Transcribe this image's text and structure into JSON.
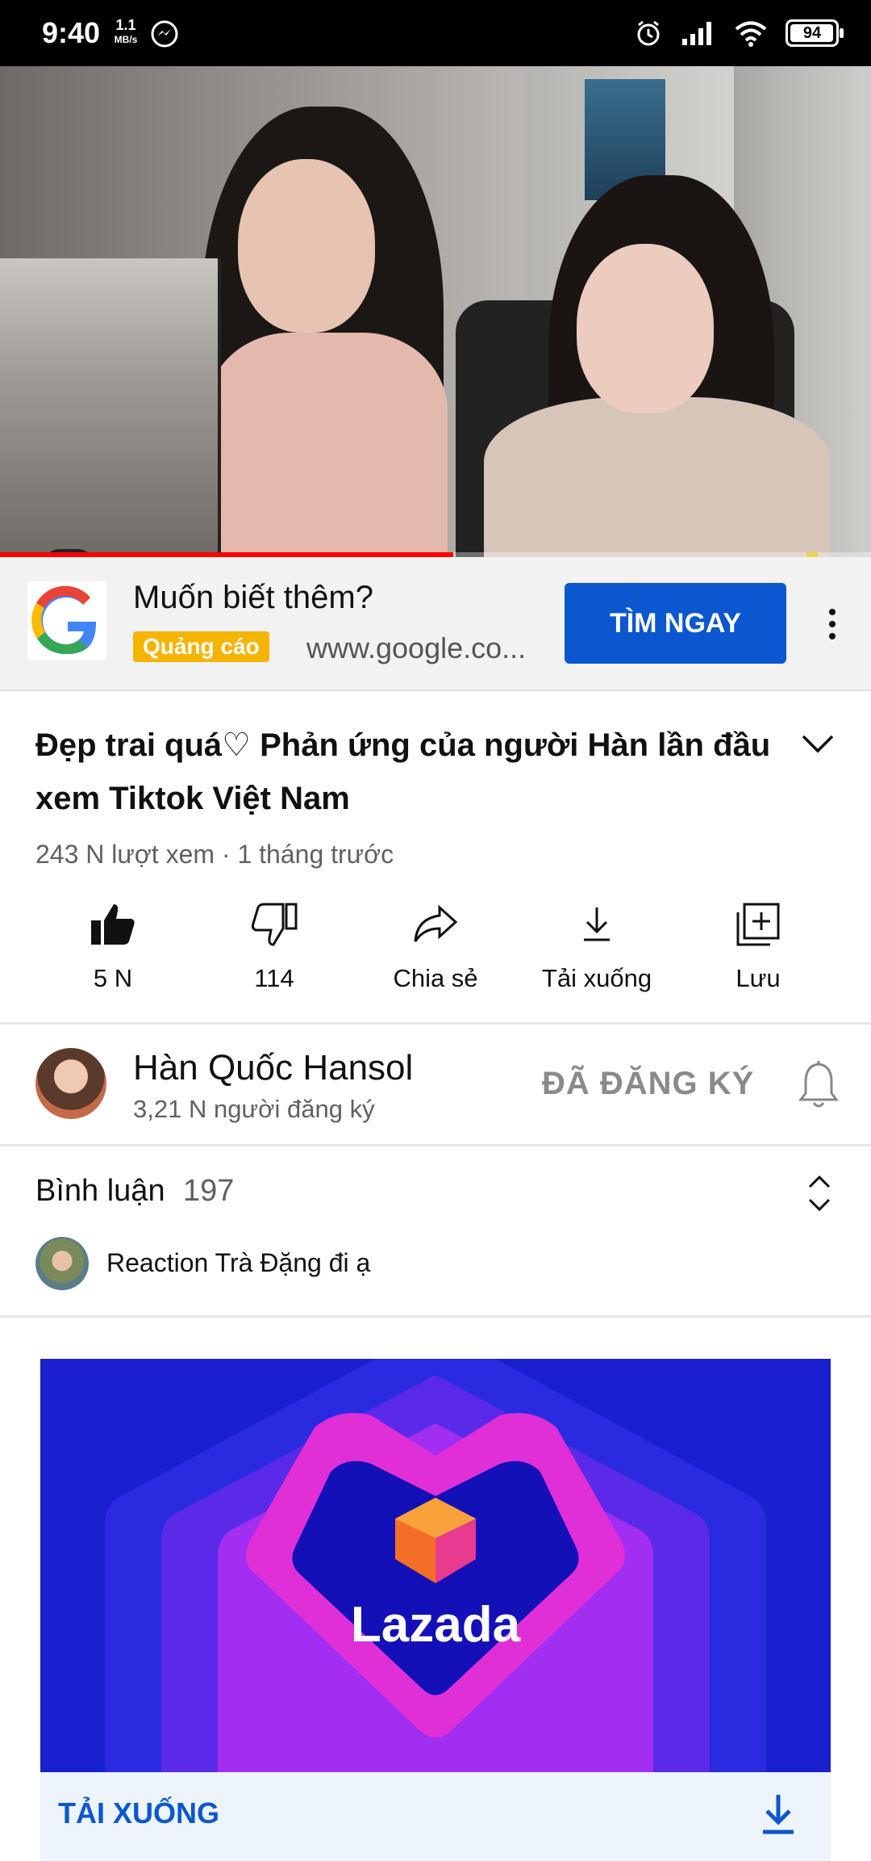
{
  "status_bar": {
    "time": "9:40",
    "speed_value": "1.1",
    "speed_unit": "MB/s",
    "battery": "94"
  },
  "player": {
    "progress_fraction": 0.52,
    "accent_color": "#ff0000"
  },
  "ad_banner": {
    "title": "Muốn biết thêm?",
    "badge": "Quảng cáo",
    "url": "www.google.co...",
    "cta": "TÌM NGAY"
  },
  "video": {
    "title": "Đẹp trai quá♡ Phản ứng của người Hàn lần đầu xem Tiktok Việt Nam",
    "meta": "243 N lượt xem · 1 tháng trước"
  },
  "actions": {
    "like": "5 N",
    "dislike": "114",
    "share": "Chia sẻ",
    "download": "Tải xuống",
    "save": "Lưu"
  },
  "channel": {
    "name": "Hàn Quốc Hansol",
    "subscribers": "3,21 N người đăng ký",
    "subscribed_label": "ĐÃ ĐĂNG KÝ"
  },
  "comments": {
    "title": "Bình luận",
    "count": "197",
    "top_comment": "Reaction Trà Đặng đi ạ"
  },
  "lazada_ad": {
    "brand": "Lazada",
    "cta": "TẢI XUỐNG"
  }
}
